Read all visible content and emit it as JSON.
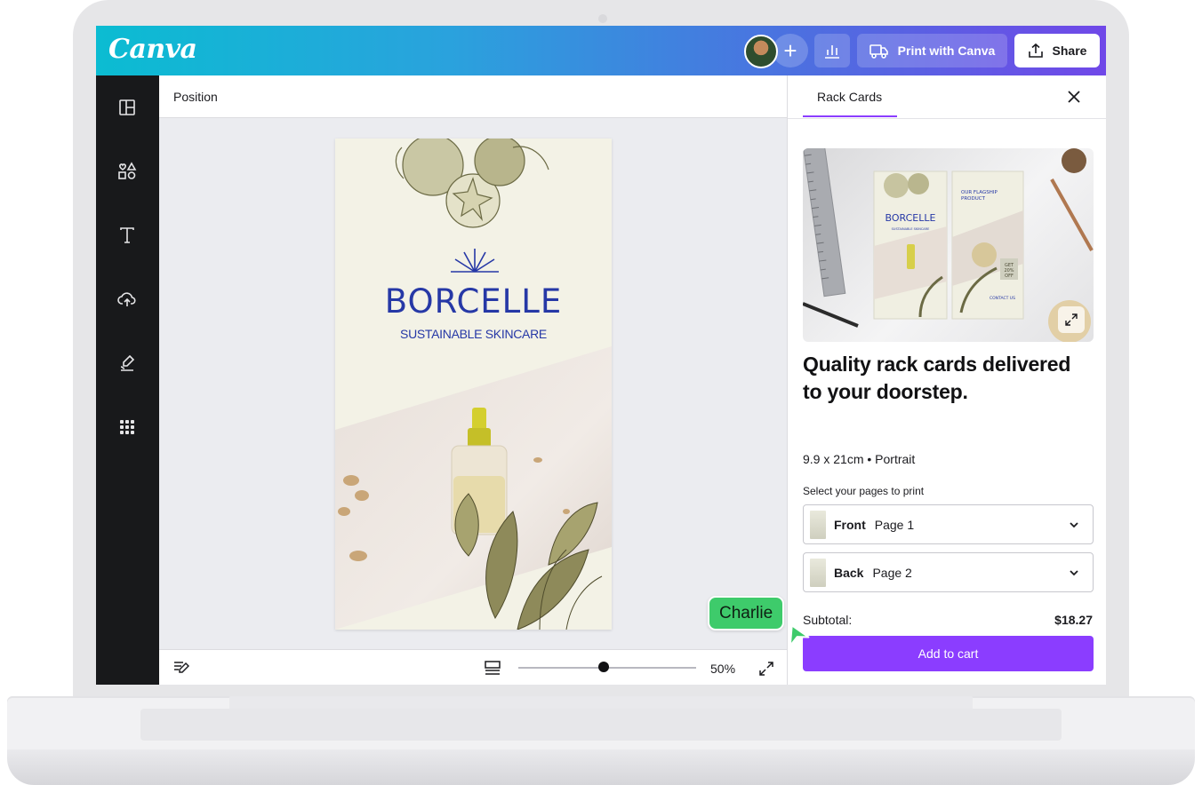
{
  "app": {
    "logo": "Canva"
  },
  "topbar": {
    "print_label": "Print with Canva",
    "share_label": "Share",
    "plus_label": "+"
  },
  "sidebar": {
    "items": [
      "layout-icon",
      "elements-icon",
      "text-icon",
      "upload-icon",
      "draw-icon",
      "apps-icon"
    ]
  },
  "editor": {
    "toolbar_label": "Position",
    "zoom": "50%",
    "zoom_fraction": 0.48
  },
  "design": {
    "brand": "BORCELLE",
    "tagline": "SUSTAINABLE SKINCARE"
  },
  "panel": {
    "tab": "Rack Cards",
    "headline": "Quality rack cards delivered to your doorstep.",
    "dimensions": "9.9 x 21cm • Portrait",
    "select_label": "Select your pages to print",
    "pages": [
      {
        "name": "Front",
        "page": "Page 1"
      },
      {
        "name": "Back",
        "page": "Page 2"
      }
    ],
    "subtotal_label": "Subtotal:",
    "subtotal_value": "$18.27",
    "cart_label": "Add to cart",
    "preview": {
      "brand": "BORCELLE",
      "tagline": "SUSTAINABLE SKINCARE",
      "flagship_1": "OUR FLAGSHIP",
      "flagship_2": "PRODUCT",
      "offer_1": "GET",
      "offer_2": "20%",
      "offer_3": "OFF",
      "contact": "CONTACT US"
    }
  },
  "collaborator": {
    "name": "Charlie"
  },
  "colors": {
    "accent": "#8b3dff",
    "brand_blue": "#2638a6",
    "cursor_green": "#3ecb6b"
  }
}
